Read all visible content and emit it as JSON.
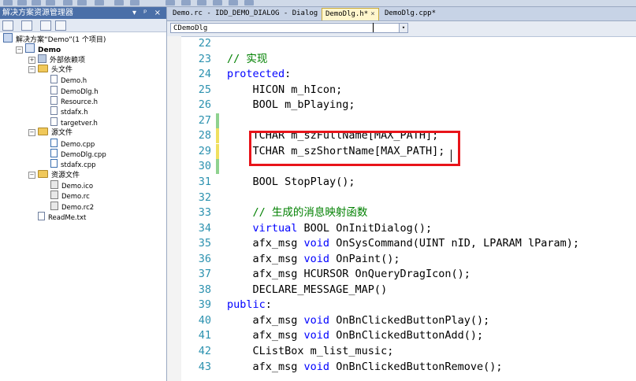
{
  "solution_explorer": {
    "title": "解决方案资源管理器",
    "title_controls": "▾ ᵖ ×",
    "items": [
      {
        "label": "解决方案“Demo”(1 个项目)",
        "icon": "solution-icon",
        "indent": 0,
        "bold": false,
        "exp": ""
      },
      {
        "label": "Demo",
        "icon": "project-icon",
        "indent": 1,
        "bold": true,
        "exp": "−"
      },
      {
        "label": "外部依赖项",
        "icon": "references-icon",
        "indent": 2,
        "bold": false,
        "exp": "+"
      },
      {
        "label": "头文件",
        "icon": "folder-icon",
        "indent": 2,
        "bold": false,
        "exp": "−"
      },
      {
        "label": "Demo.h",
        "icon": "header-file-icon",
        "indent": 3,
        "bold": false,
        "exp": ""
      },
      {
        "label": "DemoDlg.h",
        "icon": "header-file-icon",
        "indent": 3,
        "bold": false,
        "exp": ""
      },
      {
        "label": "Resource.h",
        "icon": "header-file-icon",
        "indent": 3,
        "bold": false,
        "exp": ""
      },
      {
        "label": "stdafx.h",
        "icon": "header-file-icon",
        "indent": 3,
        "bold": false,
        "exp": ""
      },
      {
        "label": "targetver.h",
        "icon": "header-file-icon",
        "indent": 3,
        "bold": false,
        "exp": ""
      },
      {
        "label": "源文件",
        "icon": "folder-icon",
        "indent": 2,
        "bold": false,
        "exp": "−"
      },
      {
        "label": "Demo.cpp",
        "icon": "cpp-file-icon",
        "indent": 3,
        "bold": false,
        "exp": ""
      },
      {
        "label": "DemoDlg.cpp",
        "icon": "cpp-file-icon",
        "indent": 3,
        "bold": false,
        "exp": ""
      },
      {
        "label": "stdafx.cpp",
        "icon": "cpp-file-icon",
        "indent": 3,
        "bold": false,
        "exp": ""
      },
      {
        "label": "资源文件",
        "icon": "folder-icon",
        "indent": 2,
        "bold": false,
        "exp": "−"
      },
      {
        "label": "Demo.ico",
        "icon": "resource-file-icon",
        "indent": 3,
        "bold": false,
        "exp": ""
      },
      {
        "label": "Demo.rc",
        "icon": "resource-file-icon",
        "indent": 3,
        "bold": false,
        "exp": ""
      },
      {
        "label": "Demo.rc2",
        "icon": "resource-file-icon",
        "indent": 3,
        "bold": false,
        "exp": ""
      },
      {
        "label": "ReadMe.txt",
        "icon": "text-file-icon",
        "indent": 2,
        "bold": false,
        "exp": ""
      }
    ]
  },
  "editor": {
    "tabs": [
      {
        "label": "Demo.rc - IDD_DEMO_DIALOG - Dialog",
        "active": false
      },
      {
        "label": "DemoDlg.h*",
        "active": true
      },
      {
        "label": "DemoDlg.cpp*",
        "active": false
      }
    ],
    "tab_close": "×",
    "class_combo": "CDemoDlg",
    "combo_arrow": "▾",
    "lines": [
      {
        "n": "22",
        "tokens": [],
        "chg": ""
      },
      {
        "n": "23",
        "tokens": [
          {
            "t": "// 实现",
            "c": "cm"
          }
        ],
        "chg": ""
      },
      {
        "n": "24",
        "tokens": [
          {
            "t": "protected",
            "c": "kw"
          },
          {
            "t": ":",
            "c": ""
          }
        ],
        "chg": ""
      },
      {
        "n": "25",
        "tokens": [
          {
            "t": "    HICON m_hIcon;",
            "c": ""
          }
        ],
        "chg": ""
      },
      {
        "n": "26",
        "tokens": [
          {
            "t": "    BOOL m_bPlaying;",
            "c": ""
          }
        ],
        "chg": ""
      },
      {
        "n": "27",
        "tokens": [],
        "chg": "#8fd28f"
      },
      {
        "n": "28",
        "tokens": [
          {
            "t": "    TCHAR m_szFullName[MAX_PATH];",
            "c": ""
          }
        ],
        "chg": "#f0e060"
      },
      {
        "n": "29",
        "tokens": [
          {
            "t": "    TCHAR m_szShortName[MAX_PATH];",
            "c": ""
          }
        ],
        "chg": "#f0e060"
      },
      {
        "n": "30",
        "tokens": [],
        "chg": "#8fd28f"
      },
      {
        "n": "31",
        "tokens": [
          {
            "t": "    BOOL StopPlay();",
            "c": ""
          }
        ],
        "chg": ""
      },
      {
        "n": "32",
        "tokens": [],
        "chg": ""
      },
      {
        "n": "33",
        "tokens": [
          {
            "t": "    ",
            "c": ""
          },
          {
            "t": "// 生成的消息映射函数",
            "c": "cm"
          }
        ],
        "chg": ""
      },
      {
        "n": "34",
        "tokens": [
          {
            "t": "    ",
            "c": ""
          },
          {
            "t": "virtual",
            "c": "kw"
          },
          {
            "t": " BOOL OnInitDialog();",
            "c": ""
          }
        ],
        "chg": ""
      },
      {
        "n": "35",
        "tokens": [
          {
            "t": "    afx_msg ",
            "c": ""
          },
          {
            "t": "void",
            "c": "kw"
          },
          {
            "t": " OnSysCommand(UINT nID, LPARAM lParam);",
            "c": ""
          }
        ],
        "chg": ""
      },
      {
        "n": "36",
        "tokens": [
          {
            "t": "    afx_msg ",
            "c": ""
          },
          {
            "t": "void",
            "c": "kw"
          },
          {
            "t": " OnPaint();",
            "c": ""
          }
        ],
        "chg": ""
      },
      {
        "n": "37",
        "tokens": [
          {
            "t": "    afx_msg HCURSOR OnQueryDragIcon();",
            "c": ""
          }
        ],
        "chg": ""
      },
      {
        "n": "38",
        "tokens": [
          {
            "t": "    DECLARE_MESSAGE_MAP()",
            "c": ""
          }
        ],
        "chg": ""
      },
      {
        "n": "39",
        "tokens": [
          {
            "t": "public",
            "c": "kw"
          },
          {
            "t": ":",
            "c": ""
          }
        ],
        "chg": ""
      },
      {
        "n": "40",
        "tokens": [
          {
            "t": "    afx_msg ",
            "c": ""
          },
          {
            "t": "void",
            "c": "kw"
          },
          {
            "t": " OnBnClickedButtonPlay();",
            "c": ""
          }
        ],
        "chg": ""
      },
      {
        "n": "41",
        "tokens": [
          {
            "t": "    afx_msg ",
            "c": ""
          },
          {
            "t": "void",
            "c": "kw"
          },
          {
            "t": " OnBnClickedButtonAdd();",
            "c": ""
          }
        ],
        "chg": ""
      },
      {
        "n": "42",
        "tokens": [
          {
            "t": "    CListBox m_list_music;",
            "c": ""
          }
        ],
        "chg": ""
      },
      {
        "n": "43",
        "tokens": [
          {
            "t": "    afx_msg ",
            "c": ""
          },
          {
            "t": "void",
            "c": "kw"
          },
          {
            "t": " OnBnClickedButtonRemove();",
            "c": ""
          }
        ],
        "chg": ""
      }
    ]
  }
}
